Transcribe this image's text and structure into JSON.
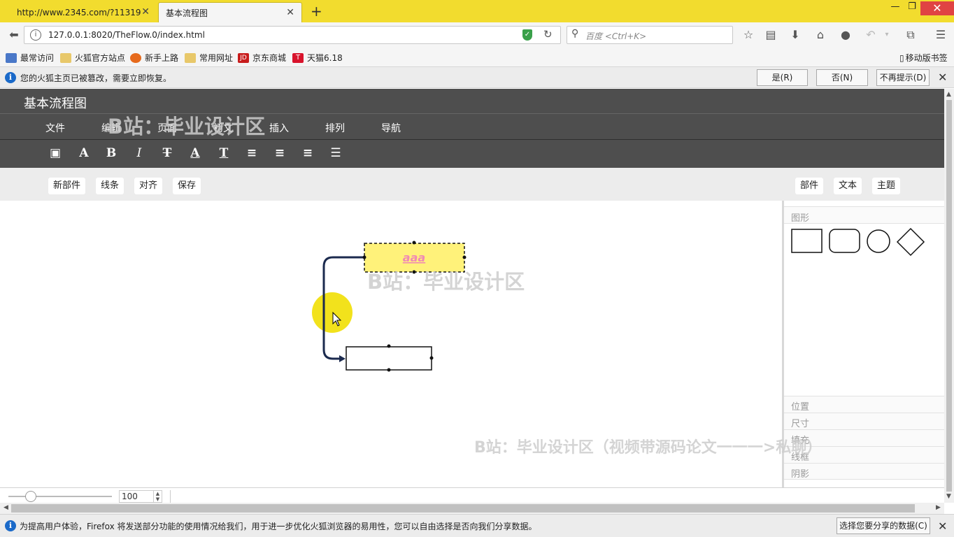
{
  "browser": {
    "tabs": [
      {
        "label": "http://www.2345.com/?11319"
      },
      {
        "label": "基本流程图"
      }
    ],
    "url": "127.0.0.1:8020/TheFlow.0/index.html",
    "search_placeholder": "百度 <Ctrl+K>",
    "bookmarks": [
      "最常访问",
      "火狐官方站点",
      "新手上路",
      "常用网址",
      "京东商城",
      "天猫6.18"
    ],
    "mobile_bookmarks": "移动版书签",
    "notification": {
      "text": "您的火狐主页已被篡改，需要立即恢复。",
      "yes": "是(R)",
      "no": "否(N)",
      "never": "不再提示(D)"
    },
    "telemetry": {
      "text": "为提高用户体验，Firefox 将发送部分功能的使用情况给我们，用于进一步优化火狐浏览器的易用性，您可以自由选择是否向我们分享数据。",
      "button": "选择您要分享的数据(C)"
    }
  },
  "app": {
    "title": "基本流程图",
    "menu": [
      "文件",
      "编辑",
      "页面",
      "初文",
      "插入",
      "排列",
      "导航"
    ],
    "toolbar_icons": [
      "save-icon",
      "font-icon",
      "bold-icon",
      "italic-icon",
      "strikethrough-icon",
      "font-color-icon",
      "text-style-icon",
      "align-left-icon",
      "align-center-icon",
      "align-right-icon",
      "align-justify-icon"
    ],
    "left_actions": [
      "新部件",
      "线条",
      "对齐",
      "保存"
    ],
    "right_tabs": [
      "部件",
      "文本",
      "主题"
    ],
    "shapes_title": "图形",
    "shapes": [
      "rectangle",
      "rounded-rectangle",
      "circle",
      "diamond"
    ],
    "properties": [
      "位置",
      "尺寸",
      "填充",
      "线框",
      "阴影"
    ],
    "zoom": "100",
    "canvas": {
      "node_text": "aaa"
    }
  },
  "watermarks": {
    "top": "B站：毕业设计区",
    "middle": "B站：毕业设计区",
    "bottom": "B站：毕业设计区（视频带源码论文一一一>私聊）"
  },
  "colors": {
    "tabbar": "#f2dc2e",
    "app_dark": "#4e4e4e",
    "selected_node_fill": "#fff27a",
    "connector": "#1b2a4e",
    "cursor_highlight": "#f2e21c"
  }
}
